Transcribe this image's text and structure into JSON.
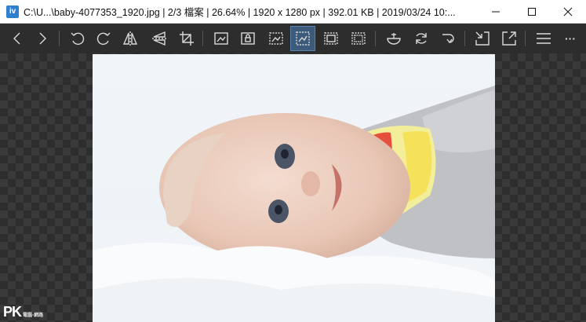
{
  "window": {
    "app_icon_label": "iv",
    "title": "C:\\U...\\baby-4077353_1920.jpg  |  2/3 檔案  |  26.64%  |  1920 x 1280 px  |  392.01 KB  |  2019/03/24 10:..."
  },
  "toolbar": {
    "buttons": [
      "previous",
      "next",
      "rotate-left",
      "rotate-right",
      "flip-horizontal",
      "flip-vertical",
      "crop",
      "fit-image",
      "lock-zoom",
      "zoom-width",
      "zoom-auto",
      "zoom-fill",
      "zoom-actual",
      "favorite-bowl",
      "refresh",
      "redo",
      "fit-window",
      "fullscreen",
      "menu",
      "more"
    ],
    "active_button": "zoom-auto",
    "more_label": "···"
  },
  "watermark": {
    "letters": "PK",
    "subtitle": "電腦‧網路"
  },
  "colors": {
    "toolbar_bg": "#2d2d2d",
    "canvas_checker": "#3a3a3a",
    "active_button": "#3c5a7a"
  }
}
